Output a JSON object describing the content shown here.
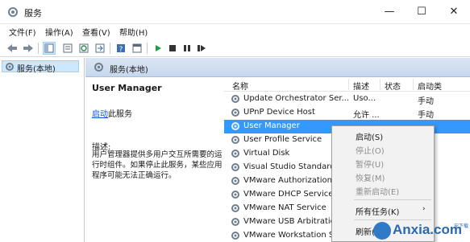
{
  "window": {
    "title": "服务",
    "minimize": "—",
    "maximize": "☐",
    "close": "✕"
  },
  "menu": [
    "文件(F)",
    "操作(A)",
    "查看(V)",
    "帮助(H)"
  ],
  "toolbar": {
    "icons": [
      "back-icon",
      "forward-icon",
      "show-tree-icon",
      "properties-icon",
      "refresh-icon",
      "export-icon",
      "help-icon",
      "console-icon",
      "start-icon",
      "stop-icon",
      "pause-icon",
      "restart-icon"
    ]
  },
  "tree": {
    "root_label": "服务(本地)"
  },
  "panel": {
    "header": "服务(本地)",
    "selected_service": "User Manager",
    "start_link": "启动",
    "start_suffix": "此服务",
    "desc_label": "描述:",
    "desc_text": "用户管理器提供多用户交互所需要的运行时组件。如果停止此服务，某些应用程序可能无法正确运行。"
  },
  "columns": {
    "name": "名称",
    "description": "描述",
    "status": "状态",
    "startup": "启动类"
  },
  "services": [
    {
      "name": "Update Orchestrator Ser...",
      "description": "Uso...",
      "status": "",
      "startup": "手动"
    },
    {
      "name": "UPnP Device Host",
      "description": "允许 ...",
      "status": "",
      "startup": "手动"
    },
    {
      "name": "User Manager",
      "description": "",
      "status": "",
      "startup": "",
      "selected": true
    },
    {
      "name": "User Profile Service",
      "description": "",
      "status": "",
      "startup": ""
    },
    {
      "name": "Virtual Disk",
      "description": "",
      "status": "",
      "startup": ""
    },
    {
      "name": "Visual Studio Standard",
      "description": "",
      "status": "",
      "startup": ""
    },
    {
      "name": "VMware Authorization",
      "description": "",
      "status": "",
      "startup": ""
    },
    {
      "name": "VMware DHCP Service",
      "description": "",
      "status": "",
      "startup": ""
    },
    {
      "name": "VMware NAT Service",
      "description": "",
      "status": "",
      "startup": ""
    },
    {
      "name": "VMware USB Arbitratio",
      "description": "",
      "status": "",
      "startup": ""
    },
    {
      "name": "VMware Workstation S",
      "description": "",
      "status": "",
      "startup": ""
    }
  ],
  "context_menu": {
    "start": "启动(S)",
    "stop": "停止(O)",
    "pause": "暂停(U)",
    "resume": "恢复(M)",
    "restart": "重新启动(E)",
    "all_tasks": "所有任务(K)",
    "all_tasks_arrow": "›",
    "refresh": "刷新(F)"
  },
  "watermark": {
    "text": "Anxia.com",
    "sub": "安下载"
  },
  "colors": {
    "selection": "#3399ff",
    "header_gradient": "#c7d7ec",
    "link": "#0b57d0"
  }
}
